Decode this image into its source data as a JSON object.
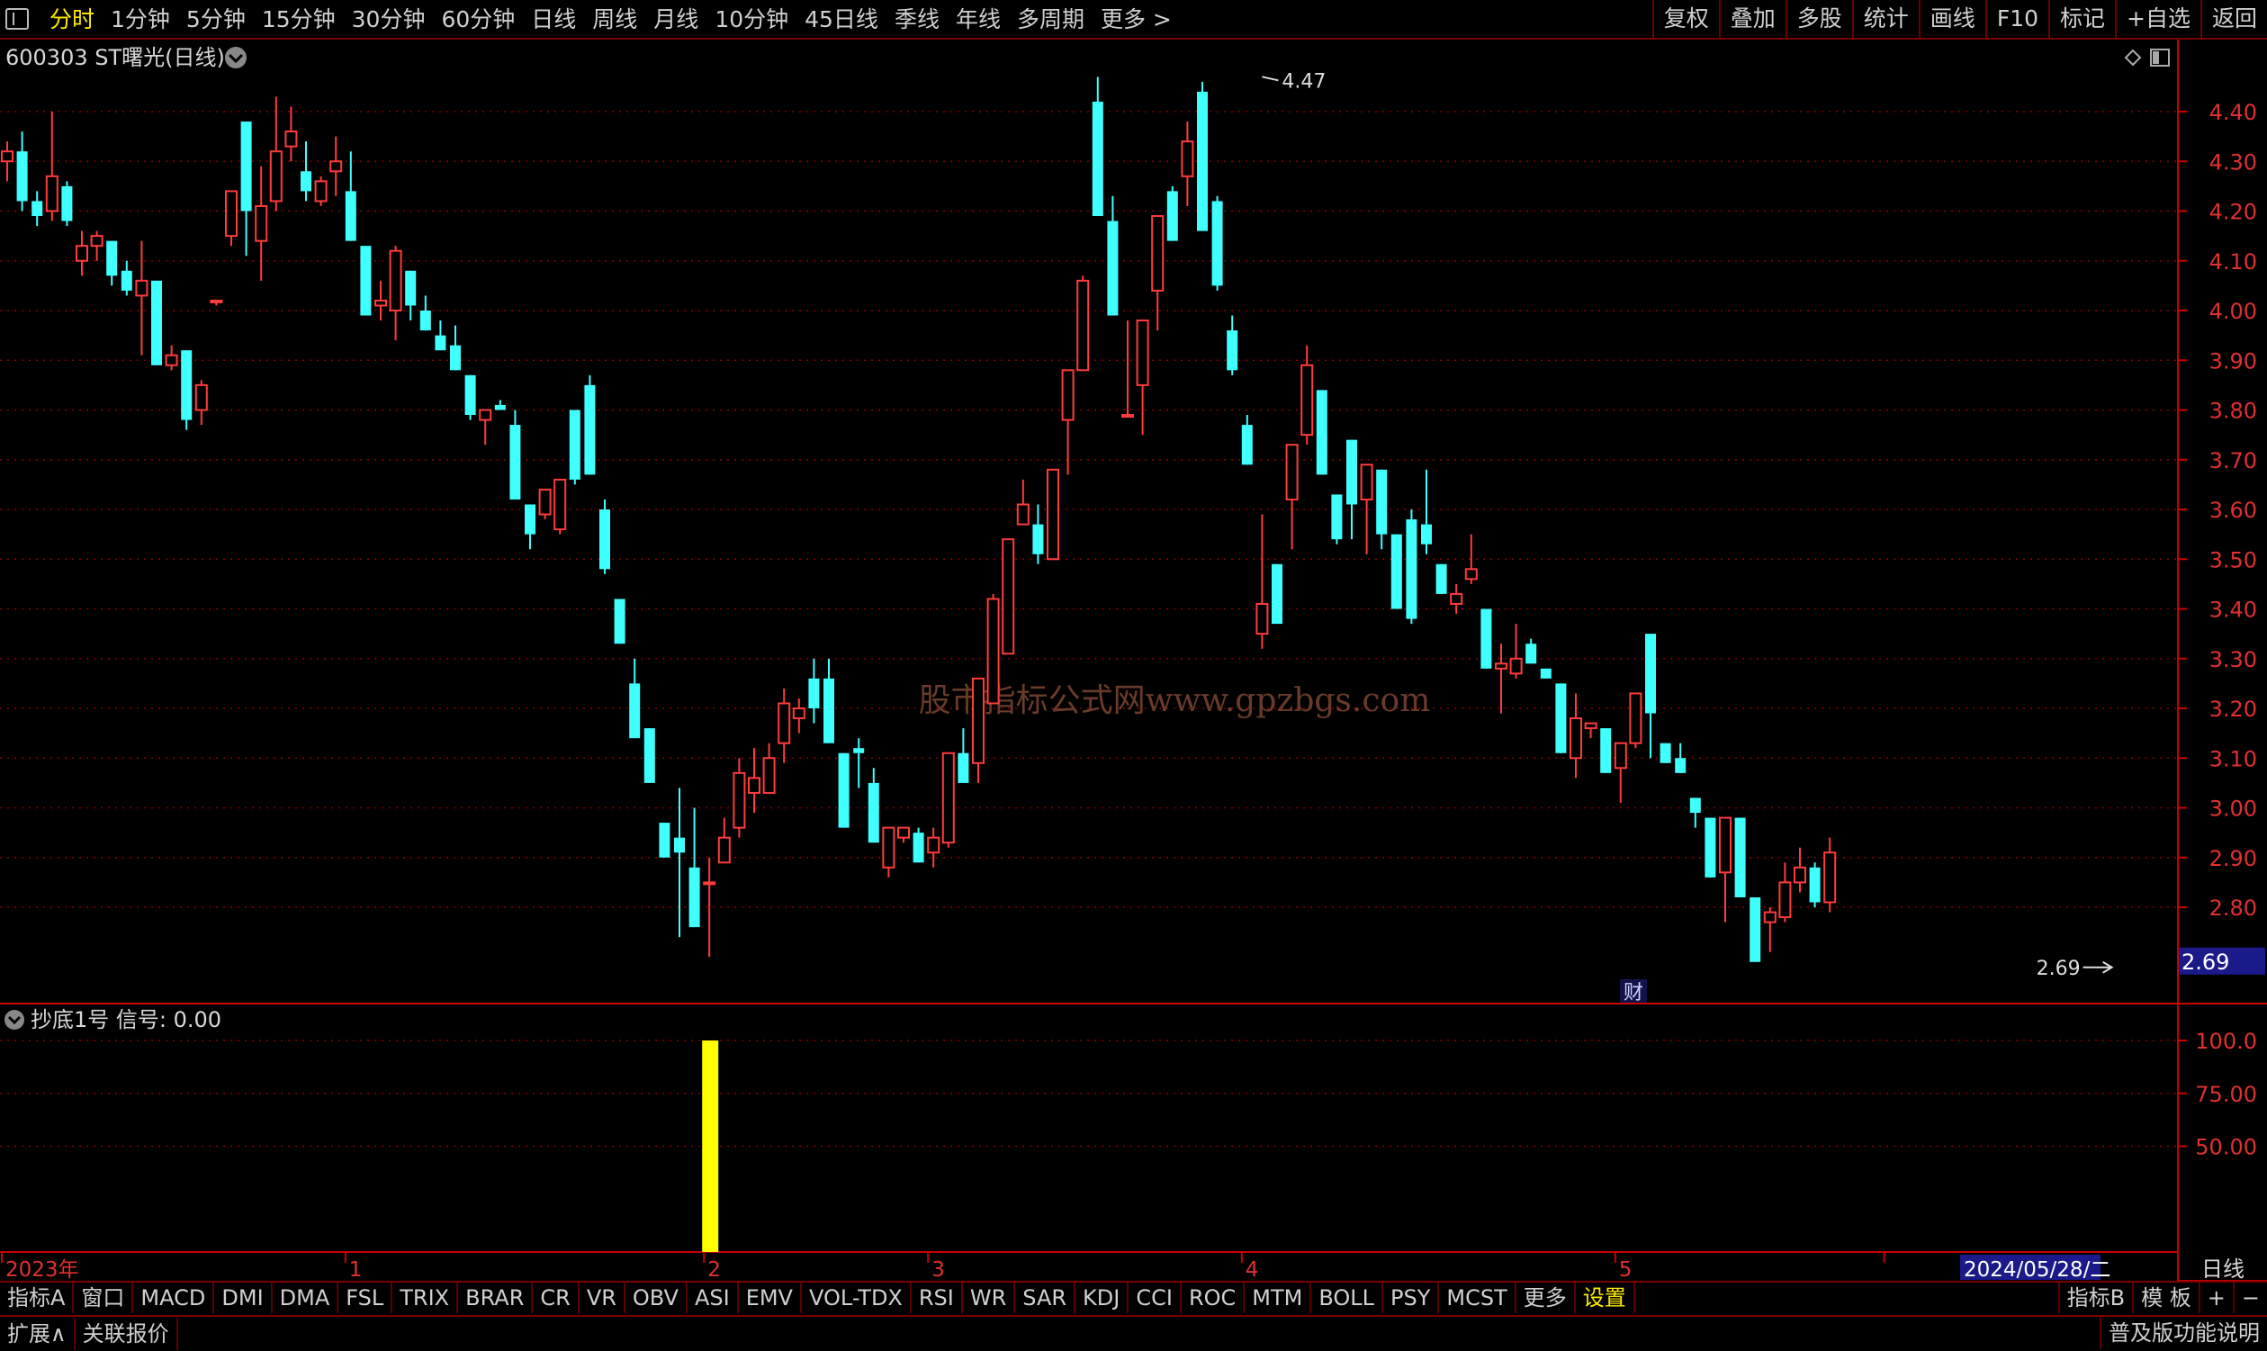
{
  "toolbar": {
    "periods": [
      "分时",
      "1分钟",
      "5分钟",
      "15分钟",
      "30分钟",
      "60分钟",
      "日线",
      "周线",
      "月线",
      "10分钟",
      "45日线",
      "季线",
      "年线",
      "多周期",
      "更多 >"
    ],
    "active_period": "分时",
    "tools": [
      "复权",
      "叠加",
      "多股",
      "统计",
      "画线",
      "F10",
      "标记",
      "+自选",
      "返回"
    ]
  },
  "main_chart": {
    "title": "600303 ST曙光(日线)",
    "watermark": "股市指标公式网www.gpzbgs.com",
    "fin_marker": "财",
    "colors": {
      "up": "#ff3b3b",
      "down": "#40ffff",
      "grid": "#8a0000",
      "axis": "#c80000",
      "label": "#e03030"
    }
  },
  "indicator": {
    "title": "抄底1号  信号: 0.00",
    "bar_color": "#ffff00"
  },
  "chart_data": [
    {
      "type": "candlestick",
      "title": "600303 ST曙光(日线)",
      "ylim": [
        2.62,
        4.5
      ],
      "ytick_labels": [
        "4.40",
        "4.30",
        "4.20",
        "4.10",
        "4.00",
        "3.90",
        "3.80",
        "3.70",
        "3.60",
        "3.50",
        "3.40",
        "3.30",
        "3.20",
        "3.10",
        "3.00",
        "2.90",
        "2.80"
      ],
      "ytick_values": [
        4.4,
        4.3,
        4.2,
        4.1,
        4.0,
        3.9,
        3.8,
        3.7,
        3.6,
        3.5,
        3.4,
        3.3,
        3.2,
        3.1,
        3.0,
        2.9,
        2.8
      ],
      "current_price_label": "2.69",
      "current_price": 2.69,
      "annotations": [
        {
          "text": "4.47",
          "value": 4.47,
          "note": "high",
          "candle": 84
        },
        {
          "text": "2.69",
          "value": 2.69,
          "note": "low",
          "candle": 141
        }
      ],
      "x_labels": [
        "2023年",
        "1",
        "2",
        "3",
        "4",
        "5",
        "2024/05/28/二"
      ],
      "x_label_candles": [
        0,
        23,
        47,
        62,
        83,
        108,
        126
      ],
      "ohlc": [
        [
          4.3,
          4.34,
          4.26,
          4.32
        ],
        [
          4.32,
          4.36,
          4.2,
          4.22
        ],
        [
          4.22,
          4.24,
          4.17,
          4.19
        ],
        [
          4.2,
          4.4,
          4.18,
          4.27
        ],
        [
          4.25,
          4.26,
          4.17,
          4.18
        ],
        [
          4.1,
          4.16,
          4.07,
          4.13
        ],
        [
          4.13,
          4.16,
          4.1,
          4.15
        ],
        [
          4.14,
          4.14,
          4.05,
          4.07
        ],
        [
          4.08,
          4.1,
          4.03,
          4.04
        ],
        [
          4.03,
          4.14,
          3.91,
          4.06
        ],
        [
          4.06,
          4.06,
          3.89,
          3.89
        ],
        [
          3.89,
          3.93,
          3.88,
          3.91
        ],
        [
          3.92,
          3.92,
          3.76,
          3.78
        ],
        [
          3.8,
          3.86,
          3.77,
          3.85
        ],
        [
          4.02,
          4.02,
          4.01,
          4.02
        ],
        [
          4.15,
          4.23,
          4.13,
          4.24
        ],
        [
          4.38,
          4.38,
          4.11,
          4.2
        ],
        [
          4.14,
          4.29,
          4.06,
          4.21
        ],
        [
          4.22,
          4.43,
          4.2,
          4.32
        ],
        [
          4.33,
          4.41,
          4.3,
          4.36
        ],
        [
          4.28,
          4.34,
          4.22,
          4.24
        ],
        [
          4.22,
          4.27,
          4.21,
          4.26
        ],
        [
          4.28,
          4.35,
          4.23,
          4.3
        ],
        [
          4.24,
          4.32,
          4.14,
          4.14
        ],
        [
          4.13,
          4.13,
          4.02,
          3.99
        ],
        [
          4.01,
          4.06,
          3.98,
          4.02
        ],
        [
          4.0,
          4.13,
          3.94,
          4.12
        ],
        [
          4.08,
          4.08,
          3.98,
          4.01
        ],
        [
          4.0,
          4.03,
          3.97,
          3.96
        ],
        [
          3.95,
          3.98,
          3.92,
          3.92
        ],
        [
          3.93,
          3.97,
          3.88,
          3.88
        ],
        [
          3.87,
          3.87,
          3.78,
          3.79
        ],
        [
          3.78,
          3.8,
          3.73,
          3.8
        ],
        [
          3.81,
          3.82,
          3.82,
          3.8
        ],
        [
          3.77,
          3.8,
          3.62,
          3.62
        ],
        [
          3.61,
          3.61,
          3.52,
          3.55
        ],
        [
          3.59,
          3.64,
          3.58,
          3.64
        ],
        [
          3.56,
          3.66,
          3.55,
          3.66
        ],
        [
          3.8,
          3.8,
          3.65,
          3.66
        ],
        [
          3.85,
          3.87,
          3.67,
          3.67
        ],
        [
          3.6,
          3.62,
          3.47,
          3.48
        ],
        [
          3.42,
          3.42,
          3.33,
          3.33
        ],
        [
          3.25,
          3.3,
          3.14,
          3.14
        ],
        [
          3.16,
          3.16,
          3.05,
          3.05
        ],
        [
          2.97,
          2.97,
          2.9,
          2.9
        ],
        [
          2.94,
          3.04,
          2.74,
          2.91
        ],
        [
          2.88,
          3.0,
          2.76,
          2.76
        ],
        [
          2.85,
          2.9,
          2.7,
          2.85
        ],
        [
          2.89,
          2.98,
          2.89,
          2.94
        ],
        [
          2.96,
          3.1,
          2.94,
          3.07
        ],
        [
          3.03,
          3.12,
          2.99,
          3.06
        ],
        [
          3.03,
          3.13,
          3.03,
          3.1
        ],
        [
          3.13,
          3.24,
          3.09,
          3.21
        ],
        [
          3.18,
          3.22,
          3.15,
          3.2
        ],
        [
          3.26,
          3.3,
          3.17,
          3.2
        ],
        [
          3.26,
          3.3,
          3.18,
          3.13
        ],
        [
          3.11,
          3.11,
          2.96,
          2.96
        ],
        [
          3.12,
          3.14,
          3.04,
          3.11
        ],
        [
          3.05,
          3.08,
          2.95,
          2.93
        ],
        [
          2.88,
          2.96,
          2.86,
          2.96
        ],
        [
          2.94,
          2.96,
          2.93,
          2.96
        ],
        [
          2.95,
          2.96,
          2.89,
          2.89
        ],
        [
          2.91,
          2.96,
          2.88,
          2.94
        ],
        [
          2.93,
          3.11,
          2.92,
          3.11
        ],
        [
          3.11,
          3.16,
          3.07,
          3.05
        ],
        [
          3.09,
          3.13,
          3.05,
          3.26
        ],
        [
          3.21,
          3.43,
          3.29,
          3.42
        ],
        [
          3.31,
          3.54,
          3.36,
          3.54
        ],
        [
          3.57,
          3.66,
          3.58,
          3.61
        ],
        [
          3.57,
          3.61,
          3.49,
          3.51
        ],
        [
          3.5,
          3.68,
          3.5,
          3.68
        ],
        [
          3.78,
          3.87,
          3.67,
          3.88
        ],
        [
          3.88,
          4.07,
          3.88,
          4.06
        ],
        [
          4.42,
          4.47,
          4.19,
          4.19
        ],
        [
          4.18,
          4.23,
          3.99,
          3.99
        ],
        [
          3.79,
          3.98,
          3.79,
          3.79
        ],
        [
          3.85,
          3.98,
          3.75,
          3.98
        ],
        [
          4.04,
          4.19,
          3.96,
          4.19
        ],
        [
          4.24,
          4.25,
          4.15,
          4.14
        ],
        [
          4.27,
          4.38,
          4.21,
          4.34
        ],
        [
          4.44,
          4.46,
          4.18,
          4.16
        ],
        [
          4.22,
          4.23,
          4.04,
          4.05
        ],
        [
          3.96,
          3.99,
          3.87,
          3.88
        ],
        [
          3.77,
          3.79,
          3.69,
          3.69
        ],
        [
          3.35,
          3.59,
          3.32,
          3.41
        ],
        [
          3.49,
          3.49,
          3.4,
          3.37
        ],
        [
          3.62,
          3.64,
          3.52,
          3.73
        ],
        [
          3.75,
          3.93,
          3.73,
          3.89
        ],
        [
          3.84,
          3.84,
          3.67,
          3.67
        ],
        [
          3.63,
          3.63,
          3.53,
          3.54
        ],
        [
          3.74,
          3.74,
          3.54,
          3.61
        ],
        [
          3.62,
          3.63,
          3.51,
          3.69
        ],
        [
          3.68,
          3.68,
          3.52,
          3.55
        ],
        [
          3.55,
          3.55,
          3.4,
          3.4
        ],
        [
          3.58,
          3.6,
          3.37,
          3.38
        ],
        [
          3.57,
          3.68,
          3.51,
          3.53
        ],
        [
          3.49,
          3.49,
          3.43,
          3.43
        ],
        [
          3.41,
          3.45,
          3.39,
          3.43
        ],
        [
          3.46,
          3.55,
          3.45,
          3.48
        ],
        [
          3.4,
          3.4,
          3.28,
          3.28
        ],
        [
          3.28,
          3.33,
          3.19,
          3.29
        ],
        [
          3.27,
          3.37,
          3.26,
          3.3
        ],
        [
          3.33,
          3.34,
          3.29,
          3.29
        ],
        [
          3.28,
          3.28,
          3.27,
          3.26
        ],
        [
          3.25,
          3.25,
          3.11,
          3.11
        ],
        [
          3.1,
          3.23,
          3.06,
          3.18
        ],
        [
          3.16,
          3.15,
          3.14,
          3.17
        ],
        [
          3.16,
          3.16,
          3.07,
          3.07
        ],
        [
          3.08,
          3.13,
          3.01,
          3.13
        ],
        [
          3.13,
          3.23,
          3.12,
          3.23
        ],
        [
          3.35,
          3.35,
          3.1,
          3.19
        ],
        [
          3.13,
          3.13,
          3.1,
          3.09
        ],
        [
          3.1,
          3.13,
          3.08,
          3.07
        ],
        [
          3.02,
          3.02,
          2.96,
          2.99
        ],
        [
          2.98,
          2.98,
          2.86,
          2.86
        ],
        [
          2.87,
          2.98,
          2.77,
          2.98
        ],
        [
          2.98,
          2.98,
          2.82,
          2.82
        ],
        [
          2.82,
          2.8,
          2.76,
          2.69
        ],
        [
          2.77,
          2.8,
          2.71,
          2.79
        ],
        [
          2.78,
          2.89,
          2.77,
          2.85
        ],
        [
          2.85,
          2.92,
          2.83,
          2.88
        ],
        [
          2.88,
          2.89,
          2.8,
          2.81
        ],
        [
          2.81,
          2.94,
          2.79,
          2.91
        ]
      ]
    },
    {
      "type": "bar",
      "title": "抄底1号",
      "ylim": [
        0,
        100
      ],
      "ytick_labels": [
        "100.0",
        "75.00",
        "50.00"
      ],
      "ytick_values": [
        100,
        75,
        50
      ],
      "signal_candle": 47,
      "signal_value": 100
    }
  ],
  "bottom": {
    "indicators": [
      "指标A",
      "窗口",
      "MACD",
      "DMI",
      "DMA",
      "FSL",
      "TRIX",
      "BRAR",
      "CR",
      "VR",
      "OBV",
      "ASI",
      "EMV",
      "VOL-TDX",
      "RSI",
      "WR",
      "SAR",
      "KDJ",
      "CCI",
      "ROC",
      "MTM",
      "BOLL",
      "PSY",
      "MCST",
      "更多",
      "设置"
    ],
    "right_tabs": [
      "指标B",
      "模 板",
      "+",
      "−"
    ],
    "status_items": [
      "扩展∧",
      "关联报价"
    ],
    "status_right": "普及版功能说明",
    "period_label": "日线"
  }
}
